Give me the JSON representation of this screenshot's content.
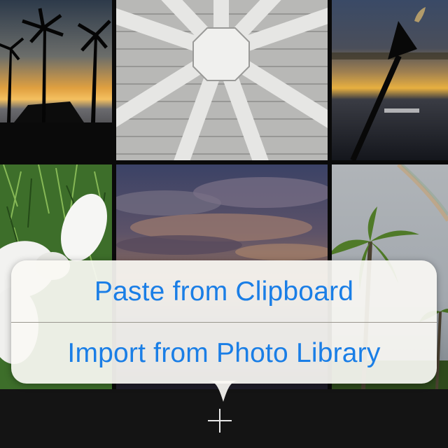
{
  "popover_menu": {
    "items": [
      {
        "label": "Paste from Clipboard"
      },
      {
        "label": "Import from Photo Library"
      }
    ],
    "label_color": "#1a7ee6"
  },
  "toolbar": {
    "add_button_icon": "plus-icon"
  },
  "photo_grid": {
    "photos": [
      {
        "subject": "palm-trees-sunset"
      },
      {
        "subject": "gazebo-ceiling"
      },
      {
        "subject": "tiki-torch-sunset"
      },
      {
        "subject": "plumeria-flower-on-grass"
      },
      {
        "subject": "cloudy-dusk-sky"
      },
      {
        "subject": "palms-with-rainbow"
      }
    ]
  }
}
